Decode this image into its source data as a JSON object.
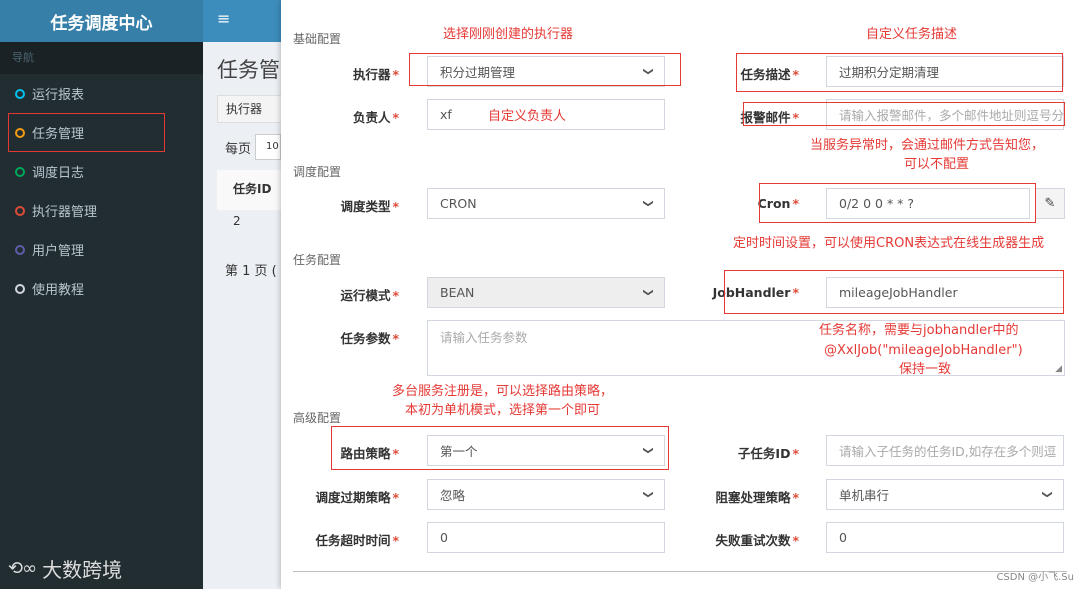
{
  "sidebar": {
    "title": "任务调度中心",
    "nav_header": "导航",
    "items": [
      {
        "label": "运行报表",
        "color": "#00c0ef"
      },
      {
        "label": "任务管理",
        "color": "#f39c12"
      },
      {
        "label": "调度日志",
        "color": "#00a65a"
      },
      {
        "label": "执行器管理",
        "color": "#dd4b39"
      },
      {
        "label": "用户管理",
        "color": "#605ca8"
      },
      {
        "label": "使用教程",
        "color": "#d2d6de"
      }
    ],
    "watermark": "大数跨境"
  },
  "background": {
    "title": "任务管",
    "executor_button": "执行器",
    "per_page_label": "每页",
    "per_page_value": "10",
    "col_task_id": "任务ID",
    "row_task_id": "2",
    "footer": "第 1 页 ( 总"
  },
  "form": {
    "sections": {
      "basic": "基础配置",
      "schedule": "调度配置",
      "task": "任务配置",
      "advanced": "高级配置"
    },
    "executor": {
      "label": "执行器",
      "value": "积分过期管理"
    },
    "job_desc": {
      "label": "任务描述",
      "value": "过期积分定期清理"
    },
    "author": {
      "label": "负责人",
      "value": "xf"
    },
    "alarm_email": {
      "label": "报警邮件",
      "placeholder": "请输入报警邮件，多个邮件地址则逗号分"
    },
    "schedule_type": {
      "label": "调度类型",
      "value": "CRON"
    },
    "cron": {
      "label": "Cron",
      "value": "0/2 0 0 * * ?"
    },
    "glue_type": {
      "label": "运行模式",
      "value": "BEAN"
    },
    "job_handler": {
      "label": "JobHandler",
      "value": "mileageJobHandler"
    },
    "job_param": {
      "label": "任务参数",
      "placeholder": "请输入任务参数"
    },
    "route_strategy": {
      "label": "路由策略",
      "value": "第一个"
    },
    "child_job": {
      "label": "子任务ID",
      "placeholder": "请输入子任务的任务ID,如存在多个则逗"
    },
    "misfire": {
      "label": "调度过期策略",
      "value": "忽略"
    },
    "block_strategy": {
      "label": "阻塞处理策略",
      "value": "单机串行"
    },
    "timeout": {
      "label": "任务超时时间",
      "value": "0"
    },
    "fail_retry": {
      "label": "失败重试次数",
      "value": "0"
    }
  },
  "annotations": {
    "executor": "选择刚刚创建的执行器",
    "job_desc": "自定义任务描述",
    "author": "自定义负责人",
    "email_line1": "当服务异常时，会通过邮件方式告知您，",
    "email_line2": "可以不配置",
    "cron": "定时时间设置，可以使用CRON表达式在线生成器生成",
    "handler_line1": "任务名称，需要与jobhandler中的",
    "handler_line2": "@XxlJob(\"mileageJobHandler\")",
    "handler_line3": "保持一致",
    "route_line1": "多台服务注册是，可以选择路由策略，",
    "route_line2": "本初为单机模式，选择第一个即可"
  },
  "csdn_credit": "CSDN @小飞.Su"
}
